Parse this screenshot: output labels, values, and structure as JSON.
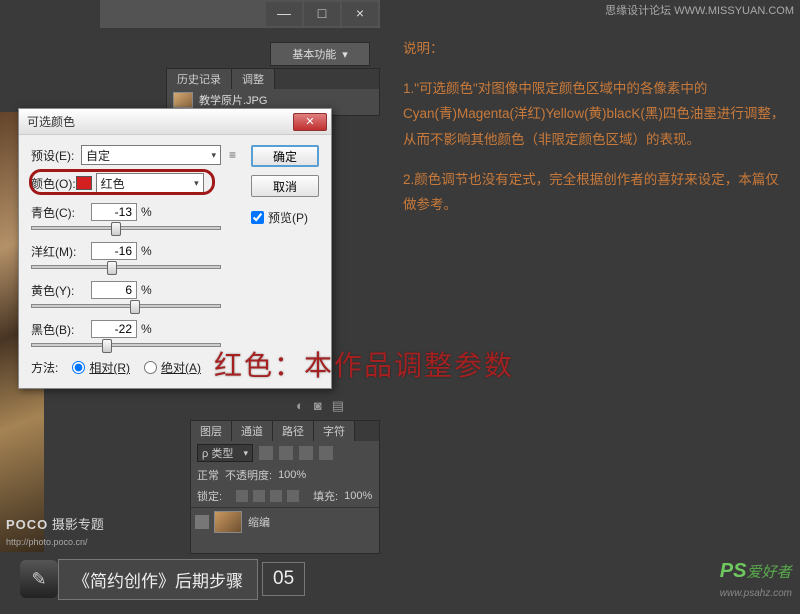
{
  "titlebar": {
    "min": "—",
    "max": "□",
    "close": "×"
  },
  "workspace_label": "基本功能",
  "history": {
    "tab1": "历史记录",
    "tab2": "调整",
    "item": "教学原片.JPG"
  },
  "dialog": {
    "title": "可选颜色",
    "ok": "确定",
    "cancel": "取消",
    "preview": "预览(P)",
    "preset_lbl": "预设(E):",
    "preset_val": "自定",
    "color_lbl": "颜色(O):",
    "color_val": "红色",
    "cyan_lbl": "青色(C):",
    "cyan_val": "-13",
    "mag_lbl": "洋红(M):",
    "mag_val": "-16",
    "yel_lbl": "黄色(Y):",
    "yel_val": "6",
    "blk_lbl": "黑色(B):",
    "blk_val": "-22",
    "pct": "%",
    "method_lbl": "方法:",
    "rel": "相对(R)",
    "abs": "绝对(A)"
  },
  "explain": {
    "heading": "说明：",
    "p1": "1.\"可选颜色\"对图像中限定颜色区域中的各像素中的Cyan(青)Magenta(洋红)Yellow(黄)blacK(黑)四色油墨进行调整，从而不影响其他颜色（非限定颜色区域）的表现。",
    "p2": "2.颜色调节也没有定式，完全根据创作者的喜好来设定，本篇仅做参考。"
  },
  "big_red": "红色：本作品调整参数",
  "layers": {
    "t1": "图层",
    "t2": "通道",
    "t3": "路径",
    "t4": "字符",
    "kind": "ρ 类型",
    "mode": "正常",
    "opacity_lbl": "不透明度:",
    "opacity_val": "100%",
    "lock_lbl": "锁定:",
    "fill_lbl": "填充:",
    "fill_val": "100%",
    "layer_name": "缩编"
  },
  "poco": {
    "brand": "POCO",
    "sub": "摄影专题",
    "url": "http://photo.poco.cn/"
  },
  "step": {
    "text": "《简约创作》后期步骤",
    "num": "05"
  },
  "wm1": "思缘设计论坛  WWW.MISSYUAN.COM",
  "wm2_brand": "PS",
  "wm2_text": "爱好者",
  "wm2_url": "www.psahz.com"
}
